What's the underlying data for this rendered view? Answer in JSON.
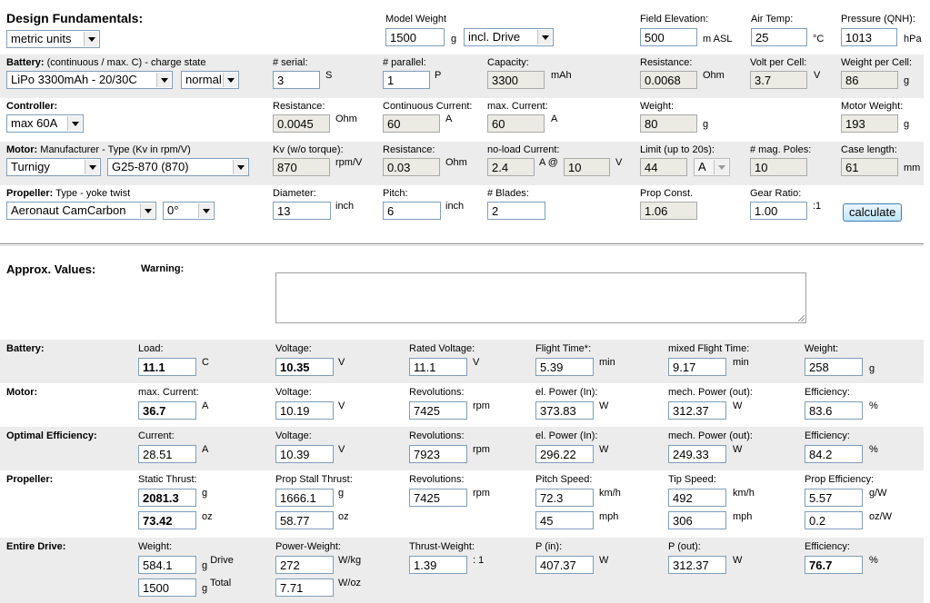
{
  "header": {
    "title": "Design Fundamentals:",
    "units_select": "metric units",
    "model_weight_label": "Model Weight",
    "model_weight": "1500",
    "model_weight_unit": "g",
    "drive_select": "incl. Drive",
    "field_elev_label": "Field Elevation:",
    "field_elev": "500",
    "field_elev_unit": "m ASL",
    "air_temp_label": "Air Temp:",
    "air_temp": "25",
    "air_temp_unit": "°C",
    "pressure_label": "Pressure (QNH):",
    "pressure": "1013",
    "pressure_unit": "hPa"
  },
  "battery": {
    "title": "Battery:",
    "subtitle": " (continuous / max. C) - charge state",
    "type_select": "LiPo 3300mAh - 20/30C",
    "state_select": "normal",
    "serial_label": "# serial:",
    "serial": "3",
    "serial_unit": "S",
    "parallel_label": "# parallel:",
    "parallel": "1",
    "parallel_unit": "P",
    "capacity_label": "Capacity:",
    "capacity": "3300",
    "capacity_unit": "mAh",
    "resistance_label": "Resistance:",
    "resistance": "0.0068",
    "resistance_unit": "Ohm",
    "vpc_label": "Volt per Cell:",
    "vpc": "3.7",
    "vpc_unit": "V",
    "wpc_label": "Weight per Cell:",
    "wpc": "86",
    "wpc_unit": "g"
  },
  "controller": {
    "title": "Controller:",
    "select": "max 60A",
    "resistance_label": "Resistance:",
    "resistance": "0.0045",
    "resistance_unit": "Ohm",
    "cont_label": "Continuous Current:",
    "cont": "60",
    "cont_unit": "A",
    "max_label": "max. Current:",
    "max": "60",
    "max_unit": "A",
    "weight_label": "Weight:",
    "weight": "80",
    "weight_unit": "g",
    "motor_weight_label": "Motor Weight:",
    "motor_weight": "193",
    "motor_weight_unit": "g"
  },
  "motor": {
    "title": "Motor:",
    "subtitle": " Manufacturer - Type (Kv in rpm/V)",
    "manufacturer_select": "Turnigy",
    "type_select": "G25-870 (870)",
    "kv_label": "Kv (w/o torque):",
    "kv": "870",
    "kv_unit": "rpm/V",
    "resistance_label": "Resistance:",
    "resistance": "0.03",
    "resistance_unit": "Ohm",
    "noload_label": "no-load Current:",
    "noload": "2.4",
    "noload_unit": "A",
    "at": "@",
    "noload_v": "10",
    "noload_v_unit": "V",
    "limit_label": "Limit (up to 20s):",
    "limit": "44",
    "limit_select": "A",
    "poles_label": "# mag. Poles:",
    "poles": "10",
    "case_label": "Case length:",
    "case": "61",
    "case_unit": "mm"
  },
  "propeller": {
    "title": "Propeller:",
    "subtitle": " Type - yoke twist",
    "type_select": "Aeronaut CamCarbon",
    "twist_select": "0°",
    "diameter_label": "Diameter:",
    "diameter": "13",
    "diameter_unit": "inch",
    "pitch_label": "Pitch:",
    "pitch": "6",
    "pitch_unit": "inch",
    "blades_label": "# Blades:",
    "blades": "2",
    "prop_const_label": "Prop Const.",
    "prop_const": "1.06",
    "gear_label": "Gear Ratio:",
    "gear": "1.00",
    "gear_unit": ":1",
    "calc_button": "calculate"
  },
  "approx": {
    "title": "Approx. Values:",
    "warning_label": "Warning:"
  },
  "r_battery": {
    "title": "Battery:",
    "load_label": "Load:",
    "load": "11.1",
    "load_unit": "C",
    "voltage_label": "Voltage:",
    "voltage": "10.35",
    "voltage_unit": "V",
    "rated_label": "Rated Voltage:",
    "rated": "11.1",
    "rated_unit": "V",
    "flight_label": "Flight Time*:",
    "flight": "5.39",
    "flight_unit": "min",
    "mixed_label": "mixed Flight Time:",
    "mixed": "9.17",
    "mixed_unit": "min",
    "weight_label": "Weight:",
    "weight": "258",
    "weight_unit": "g"
  },
  "r_motor": {
    "title": "Motor:",
    "max_label": "max. Current:",
    "max": "36.7",
    "max_unit": "A",
    "voltage_label": "Voltage:",
    "voltage": "10.19",
    "voltage_unit": "V",
    "rev_label": "Revolutions:",
    "rev": "7425",
    "rev_unit": "rpm",
    "elp_label": "el. Power (In):",
    "elp": "373.83",
    "elp_unit": "W",
    "mech_label": "mech. Power (out):",
    "mech": "312.37",
    "mech_unit": "W",
    "eff_label": "Efficiency:",
    "eff": "83.6",
    "eff_unit": "%"
  },
  "r_optimal": {
    "title": "Optimal Efficiency:",
    "cur_label": "Current:",
    "cur": "28.51",
    "cur_unit": "A",
    "voltage_label": "Voltage:",
    "voltage": "10.39",
    "voltage_unit": "V",
    "rev_label": "Revolutions:",
    "rev": "7923",
    "rev_unit": "rpm",
    "elp_label": "el. Power (In):",
    "elp": "296.22",
    "elp_unit": "W",
    "mech_label": "mech. Power (out):",
    "mech": "249.33",
    "mech_unit": "W",
    "eff_label": "Efficiency:",
    "eff": "84.2",
    "eff_unit": "%"
  },
  "r_prop": {
    "title": "Propeller:",
    "static_label": "Static Thrust:",
    "static_g": "2081.3",
    "static_g_unit": "g",
    "static_oz": "73.42",
    "static_oz_unit": "oz",
    "stall_label": "Prop Stall Thrust:",
    "stall_g": "1666.1",
    "stall_g_unit": "g",
    "stall_oz": "58.77",
    "stall_oz_unit": "oz",
    "rev_label": "Revolutions:",
    "rev": "7425",
    "rev_unit": "rpm",
    "pitch_label": "Pitch Speed:",
    "pitch_kmh": "72.3",
    "pitch_kmh_unit": "km/h",
    "pitch_mph": "45",
    "pitch_mph_unit": "mph",
    "tip_label": "Tip Speed:",
    "tip_kmh": "492",
    "tip_kmh_unit": "km/h",
    "tip_mph": "306",
    "tip_mph_unit": "mph",
    "peff_label": "Prop Efficiency:",
    "peff_gw": "5.57",
    "peff_gw_unit": "g/W",
    "peff_ozw": "0.2",
    "peff_ozw_unit": "oz/W"
  },
  "r_drive": {
    "title": "Entire Drive:",
    "weight_label": "Weight:",
    "drive_w": "584.1",
    "drive_w_unit": "g",
    "drive_w_suffix": "Drive",
    "total_w": "1500",
    "total_w_unit": "g",
    "total_w_suffix": "Total",
    "pw_label": "Power-Weight:",
    "pw_kg": "272",
    "pw_kg_unit": "W/kg",
    "pw_oz": "7.71",
    "pw_oz_unit": "W/oz",
    "tw_label": "Thrust-Weight:",
    "tw": "1.39",
    "tw_unit": ": 1",
    "pin_label": "P (in):",
    "pin": "407.37",
    "pin_unit": "W",
    "pout_label": "P (out):",
    "pout": "312.37",
    "pout_unit": "W",
    "eff_label": "Efficiency:",
    "eff": "76.7",
    "eff_unit": "%"
  }
}
